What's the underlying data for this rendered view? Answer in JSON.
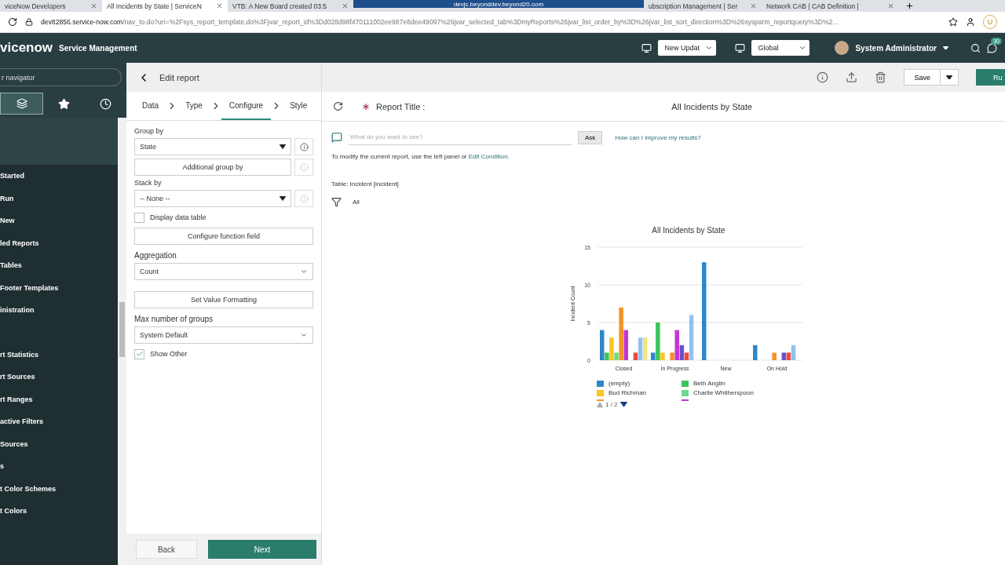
{
  "browser": {
    "tabs": [
      {
        "label": "viceNow Developers",
        "selected": false
      },
      {
        "label": "All Incidents by State | ServiceN",
        "selected": true
      },
      {
        "label": "VTB: A New Board created 03:5",
        "selected": false
      },
      {
        "label": "ubscription Management | Ser",
        "selected": false
      },
      {
        "label": "Network CAB | CAB Definition |",
        "selected": false
      }
    ],
    "remote_bar": {
      "title": "devjc.beyonddev.beyond20.com"
    },
    "url_host": "dev82856.service-now.com",
    "url_path": "/nav_to.do?uri=%2Fsys_report_template.do%3Fjvar_report_id%3Dd028d98f470111002ee987e8dee49097%26jvar_selected_tab%3DmyReports%26jvar_list_order_by%3D%26jvar_list_sort_direction%3D%26sysparm_reportquery%3D%2...",
    "profile_chip": "U"
  },
  "header": {
    "logo": "vicenow",
    "product": "Service Management",
    "update_set": "New Updat",
    "scope": "Global",
    "user": "System Administrator",
    "notification_count": "30"
  },
  "navigator": {
    "filter": {
      "placeholder": "r navigator"
    },
    "tabs": [
      {
        "kind": "all",
        "selected": true
      },
      {
        "kind": "favorites",
        "selected": false
      },
      {
        "kind": "history",
        "selected": false
      }
    ],
    "groups": [
      [
        "Started",
        "Run",
        "New",
        "led Reports",
        "Tables",
        "Footer Templates",
        "inistration"
      ],
      [
        "rt Statistics",
        "rt Sources",
        "rt Ranges",
        "active Filters",
        "Sources",
        "s",
        "t Color Schemes",
        "t Colors"
      ]
    ]
  },
  "edit_report": {
    "title": "Edit report",
    "steps": [
      {
        "label": "Data",
        "selected": false
      },
      {
        "label": "Type",
        "selected": false
      },
      {
        "label": "Configure",
        "selected": true
      },
      {
        "label": "Style",
        "selected": false
      }
    ],
    "group_by": {
      "label": "Group by",
      "value": "State"
    },
    "additional_group_by": "Additional group by",
    "stack_by": {
      "label": "Stack by",
      "value": "-- None --"
    },
    "display_data_table": {
      "label": "Display data table",
      "checked": false
    },
    "configure_function_field": "Configure function field",
    "aggregation": {
      "label": "Aggregation",
      "value": "Count"
    },
    "set_value_formatting": "Set Value Formatting",
    "max_groups": {
      "label": "Max number of groups",
      "value": "System Default"
    },
    "show_other": {
      "label": "Show Other",
      "checked": true
    },
    "back": "Back",
    "next": "Next"
  },
  "toolbar": {
    "save": "Save",
    "run": "Ru"
  },
  "report": {
    "title_label": "Report Title :",
    "title": "All Incidents by State",
    "ask": {
      "placeholder": "What do you want to see?",
      "button": "Ask",
      "help": "How can I improve my results?"
    },
    "hint": {
      "text": "To modify the current report, use the left panel or",
      "link": "Edit Condition."
    },
    "table": "Table: Incident [incident]",
    "filter": "All",
    "chart_data": {
      "type": "bar",
      "title": "All Incidents by State",
      "ylabel": "Incident Count",
      "categories": [
        "Closed",
        "In Progress",
        "New",
        "On Hold"
      ],
      "ylim": [
        0,
        15
      ],
      "yticks": [
        0,
        5,
        10,
        15
      ],
      "series": [
        {
          "name": "(empty)",
          "color": "#2f86c8",
          "values": [
            4,
            1,
            13,
            2
          ]
        },
        {
          "name": "Beth Anglin",
          "color": "#3cc45a",
          "values": [
            1,
            5,
            0,
            0
          ]
        },
        {
          "name": "Bud Richman",
          "color": "#f9c623",
          "values": [
            3,
            1,
            0,
            0
          ]
        },
        {
          "name": "Charlie Whitherspoon",
          "color": "#6ed98a",
          "values": [
            1,
            0,
            0,
            0
          ]
        },
        {
          "color": "#f39325",
          "values": [
            7,
            1,
            0,
            1
          ]
        },
        {
          "color": "#c435d3",
          "values": [
            4,
            4,
            0,
            0
          ]
        },
        {
          "color": "#6a4fc9",
          "values": [
            0,
            2,
            0,
            1
          ]
        },
        {
          "color": "#ee4b3d",
          "values": [
            1,
            1,
            0,
            1
          ]
        },
        {
          "color": "#8fc3f2",
          "values": [
            3,
            6,
            0,
            2
          ]
        },
        {
          "color": "#f3e47f",
          "values": [
            3,
            0,
            0,
            0
          ]
        }
      ]
    },
    "legend_page": "1 / 2"
  }
}
